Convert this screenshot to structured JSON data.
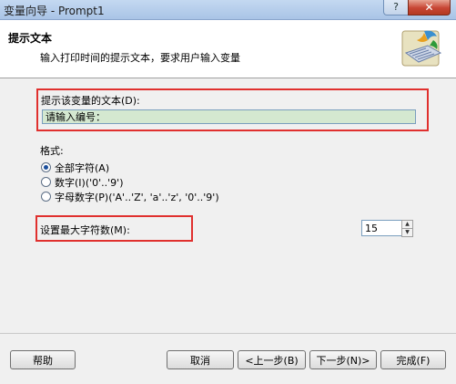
{
  "window": {
    "title": "变量向导 - Prompt1",
    "help_label": "?",
    "close_label": "✕"
  },
  "header": {
    "title": "提示文本",
    "subtitle": "输入打印时间的提示文本，要求用户输入变量",
    "icon": "wizard-keyboard-icon"
  },
  "prompt": {
    "label": "提示该变量的文本(D):",
    "value": "请输入编号："
  },
  "format": {
    "label": "格式:",
    "options": [
      {
        "label": "全部字符(A)",
        "checked": true
      },
      {
        "label": "数字(I)('0'..'9')",
        "checked": false
      },
      {
        "label": "字母数字(P)('A'..'Z', 'a'..'z', '0'..'9')",
        "checked": false
      }
    ]
  },
  "max_chars": {
    "label": "设置最大字符数(M):",
    "value": "15"
  },
  "buttons": {
    "help": "帮助",
    "cancel": "取消",
    "back": "<上一步(B)",
    "next": "下一步(N)>",
    "finish": "完成(F)"
  },
  "colors": {
    "highlight": "#e0302e",
    "input_fill": "#d4e8d0"
  }
}
